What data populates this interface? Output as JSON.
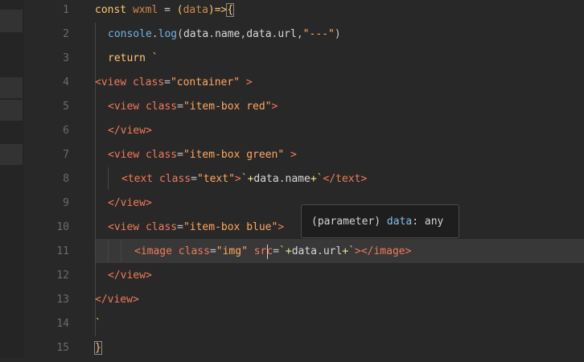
{
  "editor": {
    "line_numbers": [
      "1",
      "2",
      "3",
      "4",
      "5",
      "6",
      "7",
      "8",
      "9",
      "10",
      "11",
      "12",
      "13",
      "14",
      "15"
    ],
    "active_line": 11,
    "lines": {
      "l1": {
        "kw": "const",
        "name": " wxml",
        "eq": " = ",
        "open_paren": "(",
        "param": "data",
        "close_paren": ")",
        "arrow": "=>",
        "brace": "{"
      },
      "l2": {
        "obj": "console",
        "dot1": ".",
        "method": "log",
        "open": "(",
        "a1": "data",
        "dot2": ".",
        "a1p": "name",
        "comma1": ",",
        "a2": "data",
        "dot3": ".",
        "a2p": "url",
        "comma2": ",",
        "s": "\"---\"",
        "close": ")"
      },
      "l3": {
        "kw": "return",
        "tick": " `"
      },
      "l4": {
        "open": "<view",
        "attr": " class",
        "eq": "=",
        "val": "\"container\"",
        "close": " >"
      },
      "l5": {
        "open": "<view",
        "attr": " class",
        "eq": "=",
        "val": "\"item-box red\"",
        "close": ">"
      },
      "l6": {
        "tag": "</view>"
      },
      "l7": {
        "open": "<view",
        "attr": " class",
        "eq": "=",
        "val": "\"item-box green\"",
        "close": " >"
      },
      "l8": {
        "open": "<text",
        "attr": " class",
        "eq": "=",
        "val": "\"text\"",
        "gt": ">",
        "t1": "`",
        "p1": "+",
        "e1": "data",
        "e1d": ".",
        "e1p": "name",
        "p2": "+",
        "t2": "`",
        "endtag": "</text>"
      },
      "l9": {
        "tag": "</view>"
      },
      "l10": {
        "open": "<view",
        "attr": " class",
        "eq": "=",
        "val": "\"item-box blue\"",
        "close": ">"
      },
      "l11": {
        "open": "<image",
        "attr": " class",
        "eq": "=",
        "val": "\"img\"",
        "attr2": " src",
        "eq2": "=",
        "t1": "`",
        "p1": "+",
        "e1": "data",
        "e1d": ".",
        "e1p": "url",
        "p2": "+",
        "t2": "`",
        "gt": ">",
        "endtag": "</image>"
      },
      "l12": {
        "tag": "</view>"
      },
      "l13": {
        "tag": "</view>"
      },
      "l14": {
        "tick": "`"
      },
      "l15": {
        "brace": "}"
      }
    }
  },
  "tooltip": {
    "kind": "(parameter)",
    "name": "data",
    "colon": ":",
    "type": "any"
  },
  "colors": {
    "background": "#282828",
    "tag": "#f07a5b",
    "string": "#ffa85c",
    "keyword": "#ffc66d",
    "function": "#6fb3e4"
  }
}
